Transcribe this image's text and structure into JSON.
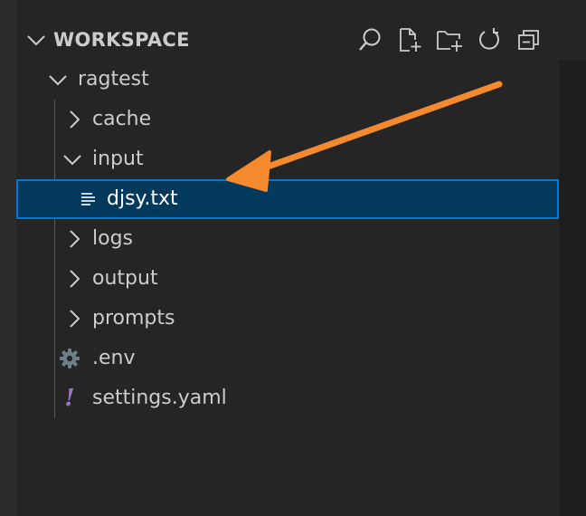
{
  "explorer": {
    "section_title": "WORKSPACE",
    "actions": [
      {
        "name": "search-icon",
        "tooltip": "Search"
      },
      {
        "name": "new-file-icon",
        "tooltip": "New File"
      },
      {
        "name": "new-folder-icon",
        "tooltip": "New Folder"
      },
      {
        "name": "refresh-icon",
        "tooltip": "Refresh"
      },
      {
        "name": "collapse-all-icon",
        "tooltip": "Collapse All"
      }
    ],
    "tree": {
      "root": {
        "label": "ragtest",
        "expanded": true
      },
      "items": [
        {
          "label": "cache",
          "type": "folder",
          "expanded": false
        },
        {
          "label": "input",
          "type": "folder",
          "expanded": true
        },
        {
          "label": "djsy.txt",
          "type": "file",
          "icon": "text-file-icon",
          "selected": true
        },
        {
          "label": "logs",
          "type": "folder",
          "expanded": false
        },
        {
          "label": "output",
          "type": "folder",
          "expanded": false
        },
        {
          "label": "prompts",
          "type": "folder",
          "expanded": false
        },
        {
          "label": ".env",
          "type": "file",
          "icon": "gear-icon"
        },
        {
          "label": "settings.yaml",
          "type": "file",
          "icon": "exclamation-icon",
          "glyph": "!"
        }
      ]
    }
  },
  "colors": {
    "sidebar_bg": "#252526",
    "selected_bg": "#04395e",
    "selected_border": "#0078d4",
    "annotation_arrow": "#f5892e",
    "yaml_icon": "#a074c4",
    "env_icon": "#6d8086"
  }
}
